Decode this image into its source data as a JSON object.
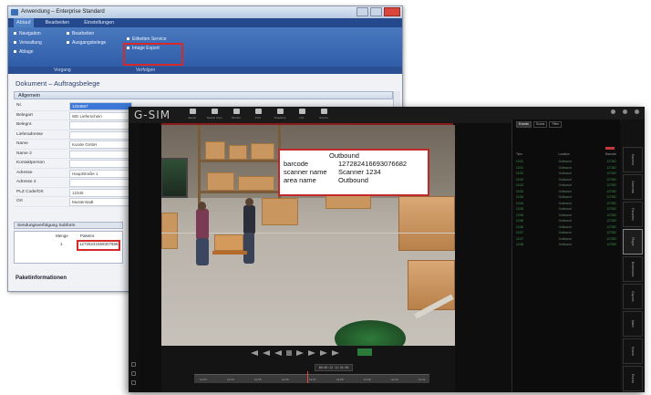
{
  "erp": {
    "title": "Anwendung – Enterprise Standard",
    "ribbon_tabs": [
      "Ablauf",
      "Bearbeiten",
      "Einstellungen"
    ],
    "ribbon_items": {
      "col1": [
        "Navigation",
        "Verwaltung",
        "Ablage"
      ],
      "col2": [
        "Bearbeiten",
        "Ausgangsbelege"
      ],
      "col3": [
        "Etiketten Service",
        "Image Export"
      ]
    },
    "group_labels": [
      "Vorgang",
      "Verfolgen"
    ],
    "document_title": "Dokument – Auftragsbelege",
    "section_title": "Allgemein",
    "form_rows": [
      {
        "label": "Nr.",
        "value": "1234567",
        "selected": true
      },
      {
        "label": "Belegart",
        "value": "WE Lieferschein"
      },
      {
        "label": "Belegnr.",
        "value": ""
      },
      {
        "label": "Lieferadresse",
        "value": ""
      },
      {
        "label": "Name",
        "value": "Kunde GmbH"
      },
      {
        "label": "Name 2",
        "value": ""
      },
      {
        "label": "Kontaktperson",
        "value": ""
      },
      {
        "label": "Adresse",
        "value": "Hauptstraße 1"
      },
      {
        "label": "Adresse 2",
        "value": ""
      },
      {
        "label": "PLZ Code/Ort",
        "value": "12345"
      },
      {
        "label": "Ort",
        "value": "Musterstadt"
      }
    ],
    "subtable_title": "Sendungsverfolgung Subform",
    "subtable_headers": [
      "Menge",
      "Paketnr."
    ],
    "subtable_row": [
      "1",
      "127282416693076682"
    ],
    "footer_label": "Paketinformationen"
  },
  "gsim": {
    "logo": "G-SIM",
    "toolbar": [
      "Export",
      "Search Cam",
      "Monitor",
      "Print",
      "Snapshot",
      "Info",
      "Events"
    ],
    "top_right": [
      "Live",
      "Search",
      "User"
    ],
    "overlay": {
      "heading": "Outbound",
      "rows": [
        {
          "key": "barcode",
          "value": "127282416693076682"
        },
        {
          "key": "scanner name",
          "value": "Scanner 1234"
        },
        {
          "key": "area name",
          "value": "Outbound"
        }
      ]
    },
    "timecode": "00:05:12 12:34:56",
    "timeline_ticks": [
      "12:33",
      "12:34",
      "12:35",
      "12:36",
      "12:37",
      "12:38",
      "12:39",
      "12:40",
      "12:41"
    ],
    "panel_tabs": [
      "Events",
      "Scans",
      "Filter"
    ],
    "panel_headers": [
      "Time",
      "Location",
      "Barcode"
    ],
    "panel_rows": [
      [
        "12:31",
        "Outbound",
        "127282"
      ],
      [
        "12:31",
        "Outbound",
        "127282"
      ],
      [
        "12:32",
        "Outbound",
        "127282"
      ],
      [
        "12:32",
        "Outbound",
        "127282"
      ],
      [
        "12:33",
        "Outbound",
        "127282"
      ],
      [
        "12:33",
        "Outbound",
        "127282"
      ],
      [
        "12:34",
        "Outbound",
        "127282"
      ],
      [
        "12:34",
        "Outbound",
        "127282"
      ],
      [
        "12:35",
        "Outbound",
        "127282"
      ],
      [
        "12:35",
        "Outbound",
        "127282"
      ],
      [
        "12:36",
        "Outbound",
        "127282"
      ],
      [
        "12:36",
        "Outbound",
        "127282"
      ],
      [
        "12:37",
        "Outbound",
        "127282"
      ],
      [
        "12:37",
        "Outbound",
        "127282"
      ],
      [
        "12:38",
        "Outbound",
        "127282"
      ]
    ],
    "vtabs": [
      "Kamera",
      "Overview",
      "Favorites",
      "Player",
      "Bookmarks",
      "Exports",
      "Alarm",
      "Search",
      "Events"
    ],
    "colors": {
      "highlight": "#c0282a",
      "accent_green": "#49a554",
      "erp_blue": "#2b58a4"
    }
  }
}
